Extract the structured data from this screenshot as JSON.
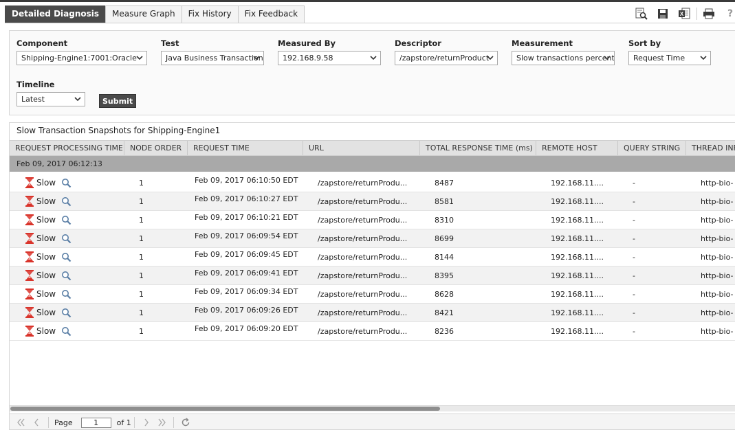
{
  "tabs": [
    {
      "label": "Detailed Diagnosis",
      "active": true
    },
    {
      "label": "Measure Graph",
      "active": false
    },
    {
      "label": "Fix History",
      "active": false
    },
    {
      "label": "Fix Feedback",
      "active": false
    }
  ],
  "toolbar": {
    "icons": [
      "inspect-icon",
      "save-icon",
      "excel-export-icon",
      "print-icon",
      "help-icon"
    ],
    "help_label": "?"
  },
  "filters": {
    "component": {
      "label": "Component",
      "value": "Shipping-Engine1:7001:Oracle"
    },
    "test": {
      "label": "Test",
      "value": "Java Business Transactions"
    },
    "measured_by": {
      "label": "Measured By",
      "value": "192.168.9.58"
    },
    "descriptor": {
      "label": "Descriptor",
      "value": "/zapstore/returnProduct"
    },
    "measurement": {
      "label": "Measurement",
      "value": "Slow transactions percent"
    },
    "sort_by": {
      "label": "Sort by",
      "value": "Request Time"
    },
    "timeline": {
      "label": "Timeline",
      "value": "Latest"
    },
    "submit_label": "Submit"
  },
  "table": {
    "title": "Slow Transaction Snapshots for Shipping-Engine1",
    "columns": [
      "REQUEST PROCESSING TIME",
      "NODE ORDER",
      "REQUEST TIME",
      "URL",
      "TOTAL RESPONSE TIME (ms)",
      "REMOTE HOST",
      "QUERY STRING",
      "THREAD INFO"
    ],
    "group_label": "Feb 09, 2017 06:12:13",
    "rows": [
      {
        "status": "Slow",
        "node": "1",
        "time": "Feb 09, 2017 06:10:50 EDT",
        "url": "/zapstore/returnProdu...",
        "resp": "8487",
        "host": "192.168.11....",
        "query": "-",
        "thread": "http-bio-"
      },
      {
        "status": "Slow",
        "node": "1",
        "time": "Feb 09, 2017 06:10:27 EDT",
        "url": "/zapstore/returnProdu...",
        "resp": "8581",
        "host": "192.168.11....",
        "query": "-",
        "thread": "http-bio-"
      },
      {
        "status": "Slow",
        "node": "1",
        "time": "Feb 09, 2017 06:10:21 EDT",
        "url": "/zapstore/returnProdu...",
        "resp": "8310",
        "host": "192.168.11....",
        "query": "-",
        "thread": "http-bio-"
      },
      {
        "status": "Slow",
        "node": "1",
        "time": "Feb 09, 2017 06:09:54 EDT",
        "url": "/zapstore/returnProdu...",
        "resp": "8699",
        "host": "192.168.11....",
        "query": "-",
        "thread": "http-bio-"
      },
      {
        "status": "Slow",
        "node": "1",
        "time": "Feb 09, 2017 06:09:45 EDT",
        "url": "/zapstore/returnProdu...",
        "resp": "8144",
        "host": "192.168.11....",
        "query": "-",
        "thread": "http-bio-"
      },
      {
        "status": "Slow",
        "node": "1",
        "time": "Feb 09, 2017 06:09:41 EDT",
        "url": "/zapstore/returnProdu...",
        "resp": "8395",
        "host": "192.168.11....",
        "query": "-",
        "thread": "http-bio-"
      },
      {
        "status": "Slow",
        "node": "1",
        "time": "Feb 09, 2017 06:09:34 EDT",
        "url": "/zapstore/returnProdu...",
        "resp": "8628",
        "host": "192.168.11....",
        "query": "-",
        "thread": "http-bio-"
      },
      {
        "status": "Slow",
        "node": "1",
        "time": "Feb 09, 2017 06:09:26 EDT",
        "url": "/zapstore/returnProdu...",
        "resp": "8421",
        "host": "192.168.11....",
        "query": "-",
        "thread": "http-bio-"
      },
      {
        "status": "Slow",
        "node": "1",
        "time": "Feb 09, 2017 06:09:20 EDT",
        "url": "/zapstore/returnProdu...",
        "resp": "8236",
        "host": "192.168.11....",
        "query": "-",
        "thread": "http-bio-"
      }
    ]
  },
  "pager": {
    "page_label": "Page",
    "page_value": "1",
    "of_label": "of 1"
  },
  "colors": {
    "active_tab": "#4a4a4a",
    "status_icon": "#d9342b",
    "group_row": "#a9a9a9"
  }
}
